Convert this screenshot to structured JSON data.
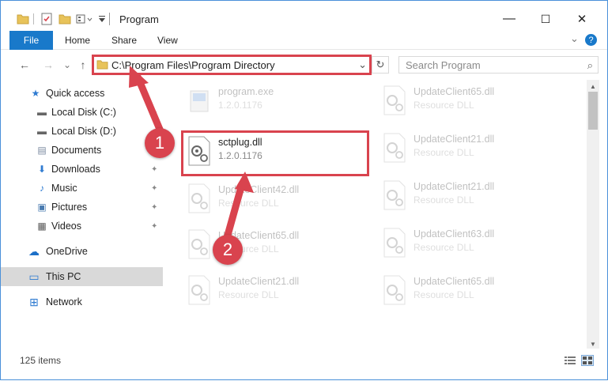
{
  "window": {
    "title": "Program",
    "controls": {
      "minimize": "—",
      "maximize": "☐",
      "close": "✕"
    }
  },
  "ribbon": {
    "file_label": "File",
    "tabs": [
      "Home",
      "Share",
      "View"
    ],
    "help_icon": "?",
    "collapse_icon": "⌄"
  },
  "nav": {
    "back_icon": "←",
    "forward_icon": "→",
    "recent_icon": "⌄",
    "up_icon": "↑",
    "address_path": "C:\\Program Files\\Program Directory",
    "address_dropdown": "⌄",
    "refresh_icon": "↻",
    "search_placeholder": "Search Program",
    "search_icon": "⌕"
  },
  "sidebar": {
    "items": [
      {
        "label": "Quick access",
        "icon": "star-icon",
        "glyph": "★",
        "pinned": false
      },
      {
        "label": "Local Disk (C:)",
        "icon": "drive-icon",
        "glyph": "▬",
        "pinned": true
      },
      {
        "label": "Local Disk (D:)",
        "icon": "drive-icon",
        "glyph": "▬",
        "pinned": false
      },
      {
        "label": "Documents",
        "icon": "documents-icon",
        "glyph": "▤",
        "pinned": true
      },
      {
        "label": "Downloads",
        "icon": "downloads-icon",
        "glyph": "⬇",
        "pinned": true
      },
      {
        "label": "Music",
        "icon": "music-icon",
        "glyph": "♪",
        "pinned": true
      },
      {
        "label": "Pictures",
        "icon": "pictures-icon",
        "glyph": "▣",
        "pinned": true
      },
      {
        "label": "Videos",
        "icon": "videos-icon",
        "glyph": "▦",
        "pinned": true
      },
      {
        "label": "OneDrive",
        "icon": "cloud-icon",
        "glyph": "☁",
        "pinned": false
      },
      {
        "label": "This PC",
        "icon": "computer-icon",
        "glyph": "▭",
        "pinned": false,
        "selected": true
      },
      {
        "label": "Network",
        "icon": "network-icon",
        "glyph": "⊞",
        "pinned": false
      }
    ],
    "pin_glyph": "📌"
  },
  "files": {
    "left": [
      {
        "name": "program.exe",
        "sub": "1.2.0.1176",
        "faded": true
      },
      {
        "name": "sctplug.dll",
        "sub": "1.2.0.1176",
        "faded": false
      },
      {
        "name": "UpdateClient42.dll",
        "sub": "Resource DLL",
        "faded": true
      },
      {
        "name": "UpdateClient65.dll",
        "sub": "Resource DLL",
        "faded": true
      },
      {
        "name": "UpdateClient21.dll",
        "sub": "Resource DLL",
        "faded": true
      }
    ],
    "right": [
      {
        "name": "UpdateClient65.dll",
        "sub": "Resource DLL",
        "faded": true
      },
      {
        "name": "UpdateClient21.dll",
        "sub": "Resource DLL",
        "faded": true
      },
      {
        "name": "UpdateClient21.dll",
        "sub": "Resource DLL",
        "faded": true
      },
      {
        "name": "UpdateClient63.dll",
        "sub": "Resource DLL",
        "faded": true
      },
      {
        "name": "UpdateClient65.dll",
        "sub": "Resource DLL",
        "faded": true
      }
    ]
  },
  "status": {
    "item_count": "125 items"
  },
  "annotations": {
    "step1": "1",
    "step2": "2",
    "accent_color": "#d9434e"
  }
}
